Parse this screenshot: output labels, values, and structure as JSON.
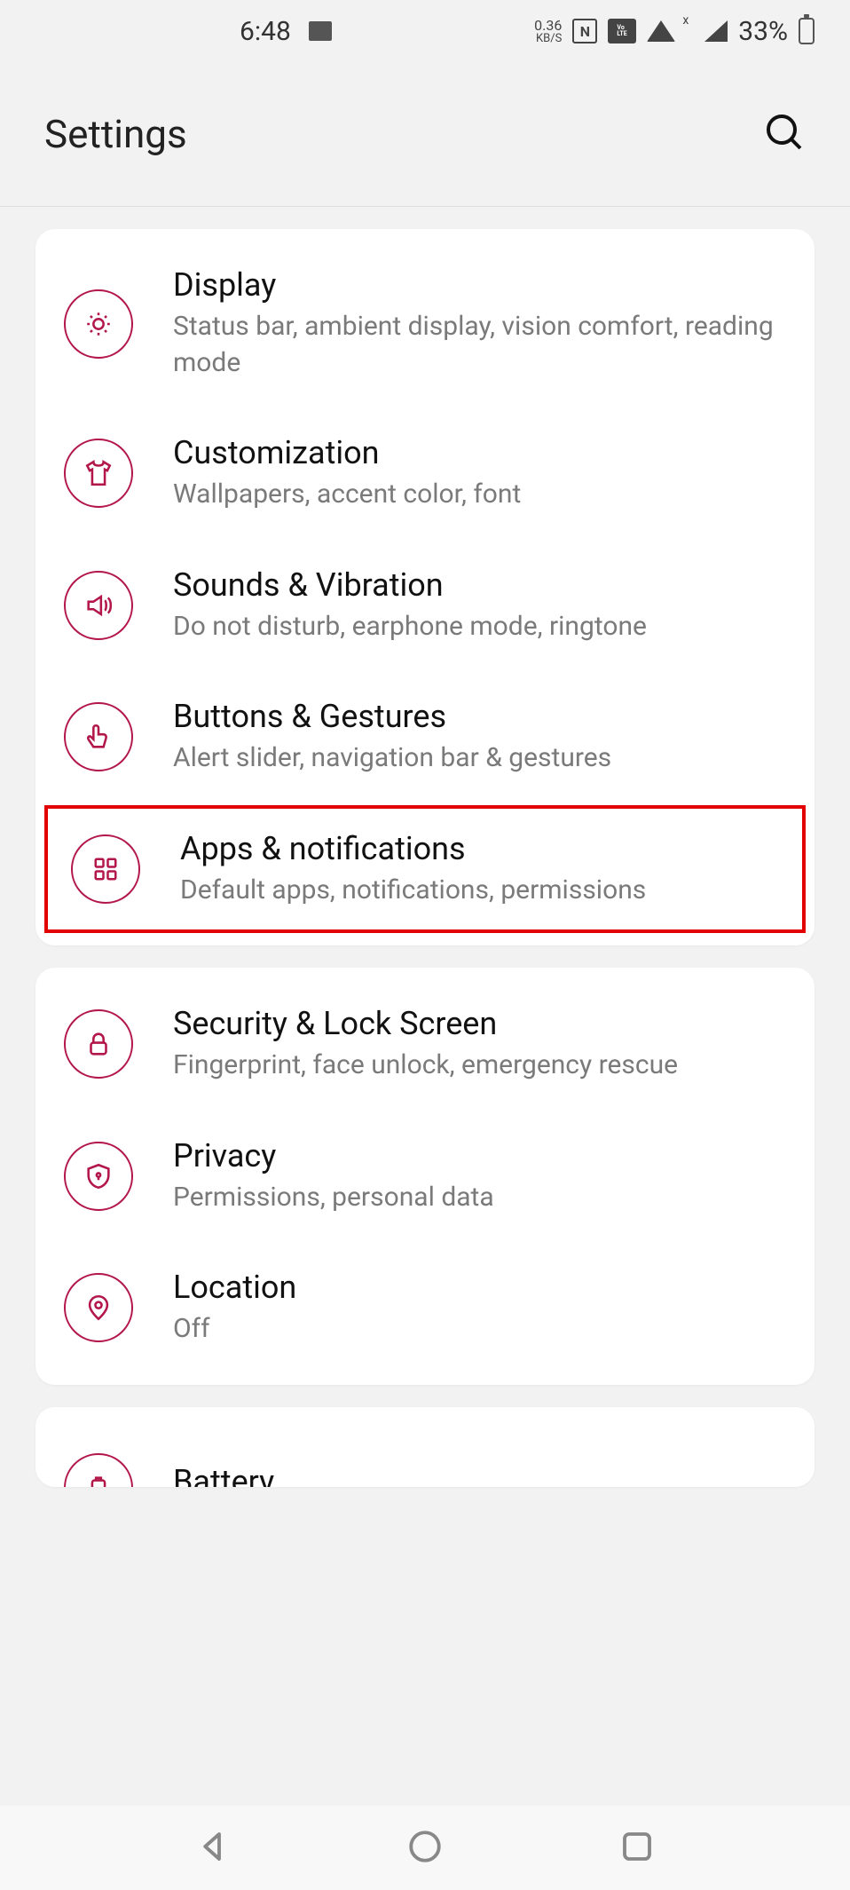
{
  "status": {
    "time": "6:48",
    "data_rate": "0.36",
    "data_unit": "KB/S",
    "nfc": "N",
    "volte": "VoLTE",
    "cell_x": "x",
    "battery_pct": "33%"
  },
  "header": {
    "title": "Settings"
  },
  "groups": [
    {
      "items": [
        {
          "id": "display",
          "title": "Display",
          "subtitle": "Status bar, ambient display, vision comfort, reading mode"
        },
        {
          "id": "customization",
          "title": "Customization",
          "subtitle": "Wallpapers, accent color, font"
        },
        {
          "id": "sounds",
          "title": "Sounds & Vibration",
          "subtitle": "Do not disturb, earphone mode, ringtone"
        },
        {
          "id": "buttons",
          "title": "Buttons & Gestures",
          "subtitle": "Alert slider, navigation bar & gestures"
        },
        {
          "id": "apps",
          "title": "Apps & notifications",
          "subtitle": "Default apps, notifications, permissions",
          "highlighted": true
        }
      ]
    },
    {
      "items": [
        {
          "id": "security",
          "title": "Security & Lock Screen",
          "subtitle": "Fingerprint, face unlock, emergency rescue"
        },
        {
          "id": "privacy",
          "title": "Privacy",
          "subtitle": "Permissions, personal data"
        },
        {
          "id": "location",
          "title": "Location",
          "subtitle": "Off"
        }
      ]
    },
    {
      "items": [
        {
          "id": "battery",
          "title": "Battery",
          "subtitle": ""
        }
      ]
    }
  ],
  "accent_color": "#b3174a",
  "highlight_color": "#e30000"
}
